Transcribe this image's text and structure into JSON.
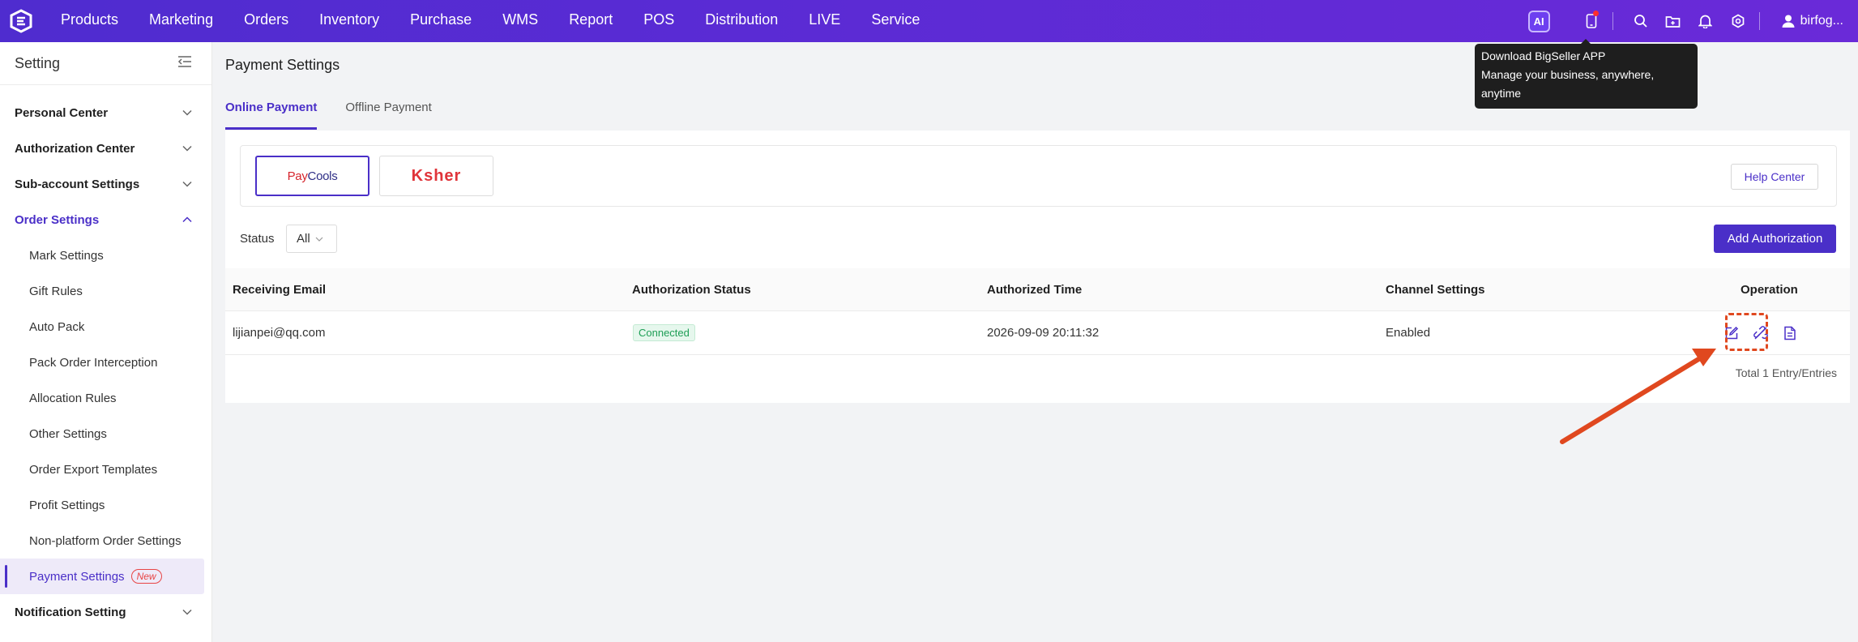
{
  "topbar": {
    "nav": [
      "Products",
      "Marketing",
      "Orders",
      "Inventory",
      "Purchase",
      "WMS",
      "Report",
      "POS",
      "Distribution",
      "LIVE",
      "Service"
    ],
    "ai_label": "AI",
    "user": "birfog...",
    "icons": [
      "app-download-icon",
      "search-icon",
      "folder-icon",
      "bell-icon",
      "settings-icon",
      "user-icon"
    ]
  },
  "tooltip": {
    "line1": "Download BigSeller APP",
    "line2": "Manage your business, anywhere,",
    "line3": "anytime"
  },
  "sidebar": {
    "title": "Setting",
    "groups": [
      {
        "label": "Personal Center"
      },
      {
        "label": "Authorization Center"
      },
      {
        "label": "Sub-account Settings"
      },
      {
        "label": "Order Settings"
      }
    ],
    "order_items": [
      {
        "label": "Mark Settings"
      },
      {
        "label": "Gift Rules"
      },
      {
        "label": "Auto Pack"
      },
      {
        "label": "Pack Order Interception"
      },
      {
        "label": "Allocation Rules"
      },
      {
        "label": "Other Settings"
      },
      {
        "label": "Order Export Templates"
      },
      {
        "label": "Profit Settings"
      },
      {
        "label": "Non-platform Order Settings"
      },
      {
        "label": "Payment Settings",
        "tag": "New"
      }
    ],
    "last_group": "Notification Setting"
  },
  "main": {
    "title": "Payment Settings",
    "tabs": [
      "Online Payment",
      "Offline Payment"
    ],
    "providers": {
      "paycools_a": "Pay",
      "paycools_b": "Cools",
      "ksher": "Ksher"
    },
    "help_center": "Help Center",
    "status_label": "Status",
    "status_value": "All",
    "add_button": "Add Authorization",
    "table": {
      "headers": [
        "Receiving Email",
        "Authorization Status",
        "Authorized Time",
        "Channel Settings",
        "Operation"
      ],
      "rows": [
        {
          "email": "lijianpei@qq.com",
          "status": "Connected",
          "time": "2026-09-09 20:11:32",
          "channel": "Enabled"
        }
      ]
    },
    "total": "Total 1 Entry/Entries"
  },
  "colors": {
    "brand": "#4a2fc8",
    "annotation": "#e0481f",
    "connected": "#1e9e56"
  }
}
